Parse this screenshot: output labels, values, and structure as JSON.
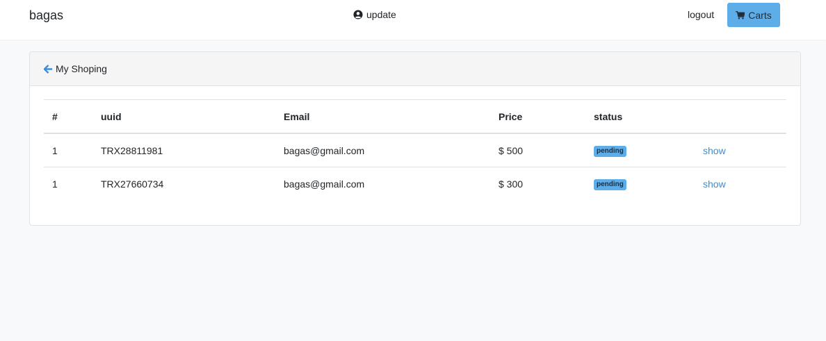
{
  "nav": {
    "brand": "bagas",
    "update_label": "update",
    "logout_label": "logout",
    "carts_label": "Carts"
  },
  "card": {
    "header_title": "My Shoping"
  },
  "table": {
    "headers": [
      "#",
      "uuid",
      "Email",
      "Price",
      "status",
      ""
    ],
    "rows": [
      {
        "num": "1",
        "uuid": "TRX28811981",
        "email": "bagas@gmail.com",
        "price": "$ 500",
        "status": "pending",
        "action": "show"
      },
      {
        "num": "1",
        "uuid": "TRX27660734",
        "email": "bagas@gmail.com",
        "price": "$ 300",
        "status": "pending",
        "action": "show"
      }
    ]
  },
  "colors": {
    "accent": "#5dade8",
    "link": "#3b8dd6",
    "background": "#f8f9fb"
  },
  "icons": {
    "update": "user-circle-icon",
    "carts": "shopping-cart-icon",
    "back": "arrow-left-icon"
  }
}
